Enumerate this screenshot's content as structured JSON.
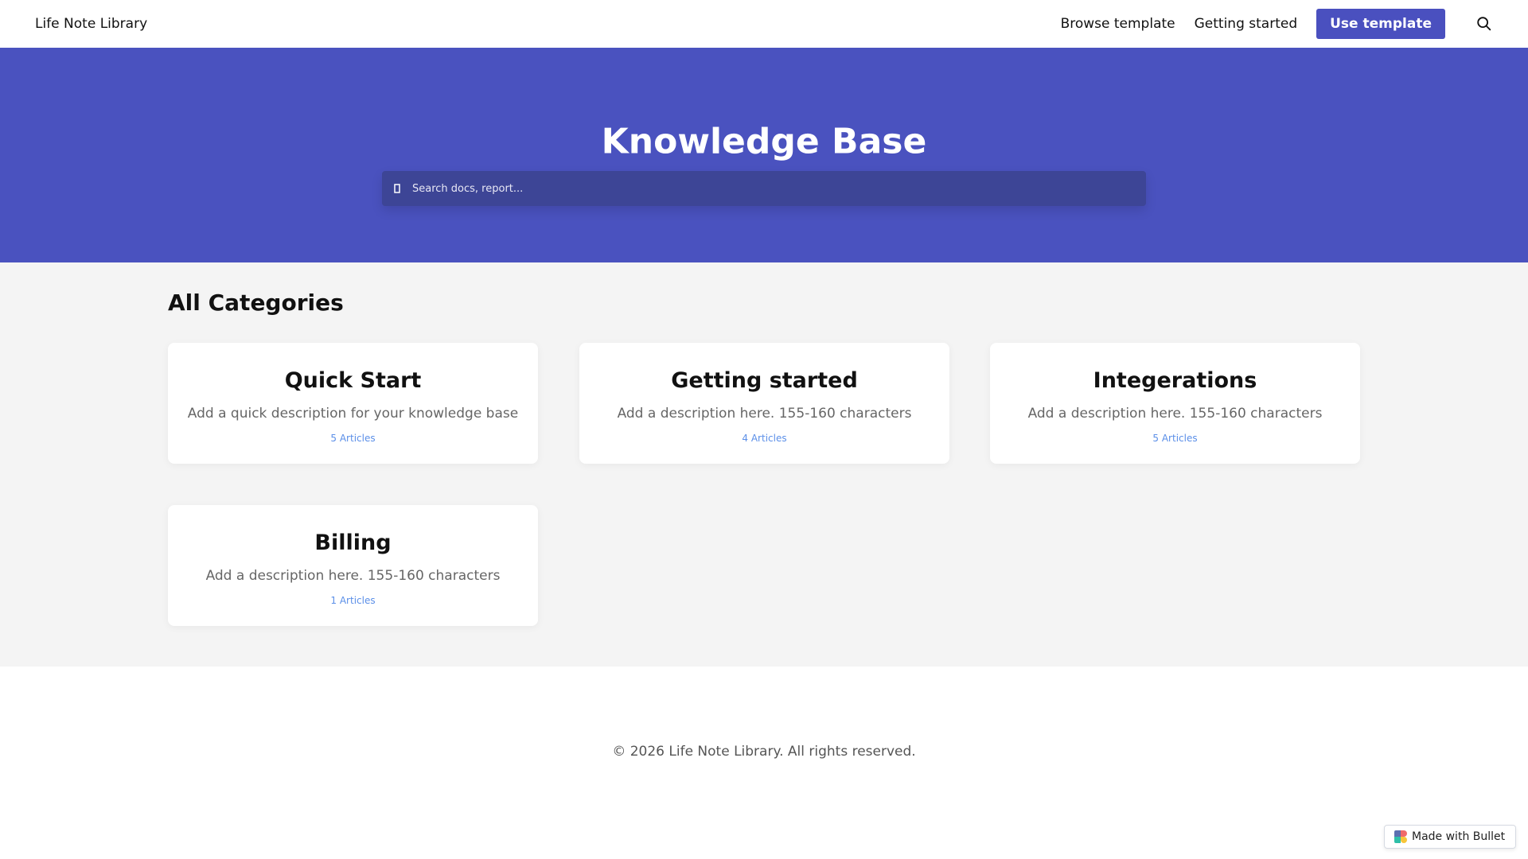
{
  "nav": {
    "brand": "Life Note Library",
    "links": [
      "Browse template",
      "Getting started"
    ],
    "cta": "Use template"
  },
  "hero": {
    "title": "Knowledge Base",
    "search_placeholder": "Search docs, report..."
  },
  "main": {
    "heading": "All Categories",
    "categories": [
      {
        "title": "Quick Start",
        "description": "Add a quick description for your knowledge base",
        "count": "5 Articles"
      },
      {
        "title": "Getting started",
        "description": "Add a description here. 155-160 characters",
        "count": "4 Articles"
      },
      {
        "title": "Integerations",
        "description": "Add a description here. 155-160 characters",
        "count": "5 Articles"
      },
      {
        "title": "Billing",
        "description": "Add a description here. 155-160 characters",
        "count": "1 Articles"
      }
    ]
  },
  "footer": {
    "text": "© 2026 Life Note Library. All rights reserved."
  },
  "badge": {
    "label": "Made with Bullet"
  },
  "colors": {
    "brand": "#4a52bf",
    "link": "#5b8fe8"
  }
}
